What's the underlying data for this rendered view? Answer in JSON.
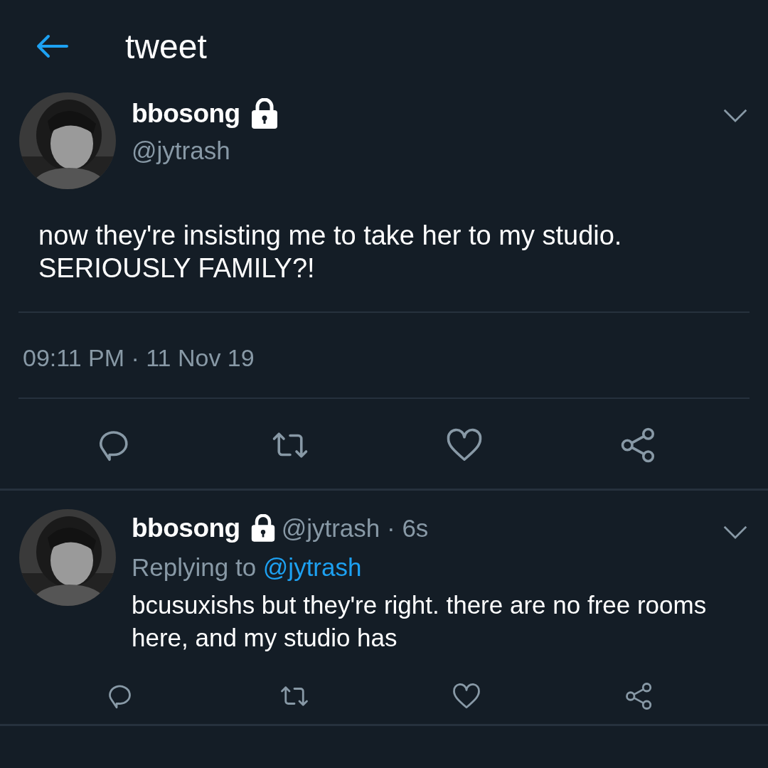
{
  "header": {
    "title": "tweet"
  },
  "tweet": {
    "name": "bbosong",
    "protected": true,
    "handle": "@jytrash",
    "text": "now they're insisting me to take her to my studio. SERIOUSLY FAMILY?!",
    "timestamp": "09:11 PM · 11 Nov 19"
  },
  "replies": [
    {
      "name": "bbosong",
      "protected": true,
      "meta": "@jytrash · 6s",
      "replying_label": "Replying to",
      "replying_handle": "@jytrash",
      "text": "bcusuxishs but they're right. there are no free rooms here, and my studio has"
    }
  ]
}
